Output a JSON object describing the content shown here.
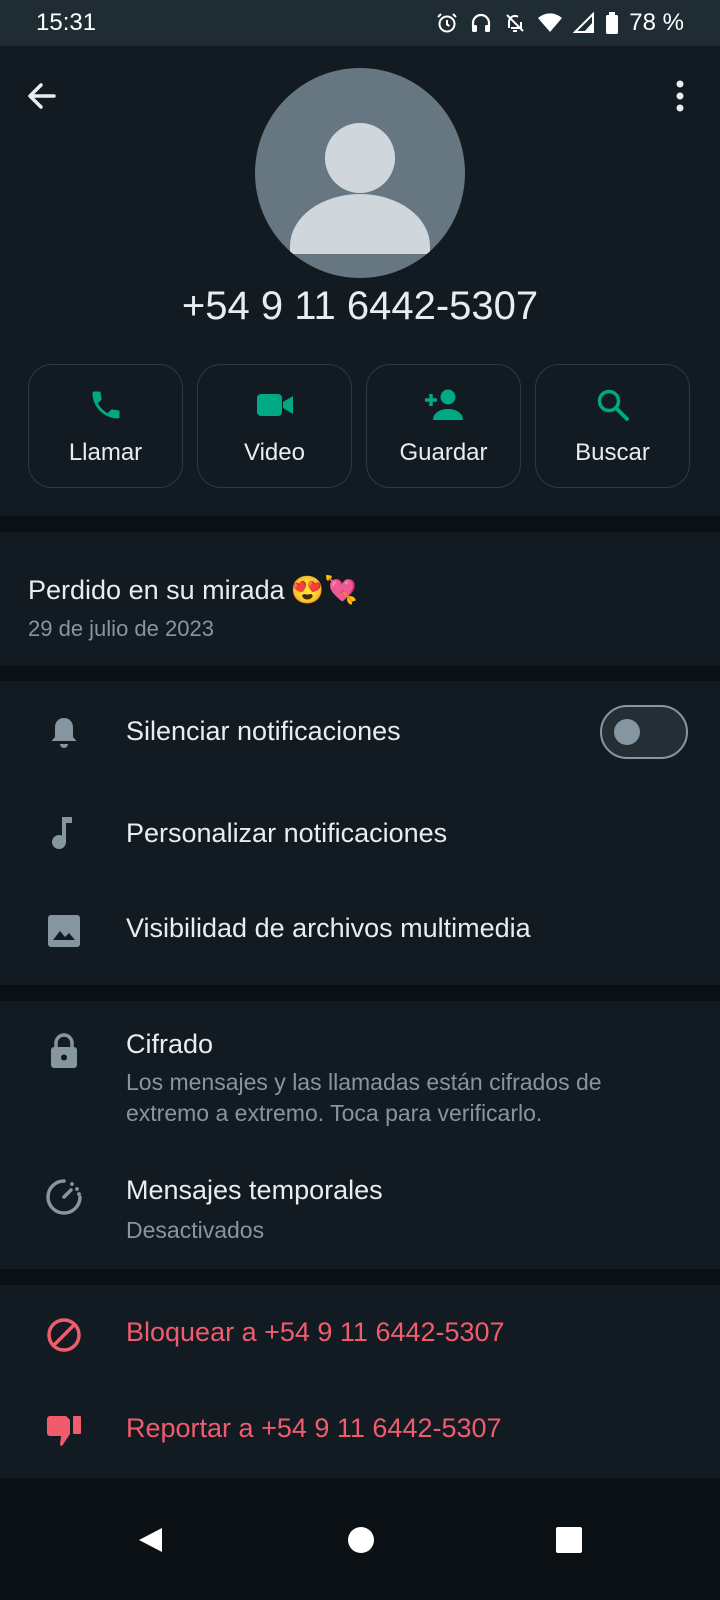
{
  "status_bar": {
    "time": "15:31",
    "battery": "78 %",
    "icons": [
      "alarm-icon",
      "headphones-icon",
      "notifications-off-icon",
      "wifi-icon",
      "signal-icon",
      "battery-icon"
    ]
  },
  "header": {
    "phone": "+54 9 11 6442-5307",
    "actions": [
      {
        "label": "Llamar",
        "icon": "phone-icon"
      },
      {
        "label": "Video",
        "icon": "videocam-icon"
      },
      {
        "label": "Guardar",
        "icon": "add-contact-icon"
      },
      {
        "label": "Buscar",
        "icon": "search-icon"
      }
    ]
  },
  "about": {
    "text": "Perdido en su mirada",
    "emoji": "😍💘",
    "date": "29 de julio de 2023"
  },
  "notifications": {
    "mute_label": "Silenciar notificaciones",
    "mute_enabled": false,
    "custom_label": "Personalizar notificaciones",
    "media_label": "Visibilidad de archivos multimedia"
  },
  "privacy": {
    "encryption_label": "Cifrado",
    "encryption_desc": "Los mensajes y las llamadas están cifrados de extremo a extremo. Toca para verificarlo.",
    "disappearing_label": "Mensajes temporales",
    "disappearing_value": "Desactivados"
  },
  "danger": {
    "block_label": "Bloquear a +54 9 11 6442-5307",
    "report_label": "Reportar a +54 9 11 6442-5307"
  },
  "colors": {
    "accent": "#00a884",
    "danger": "#f15c6d",
    "background": "#0b1014",
    "surface": "#121b22"
  }
}
